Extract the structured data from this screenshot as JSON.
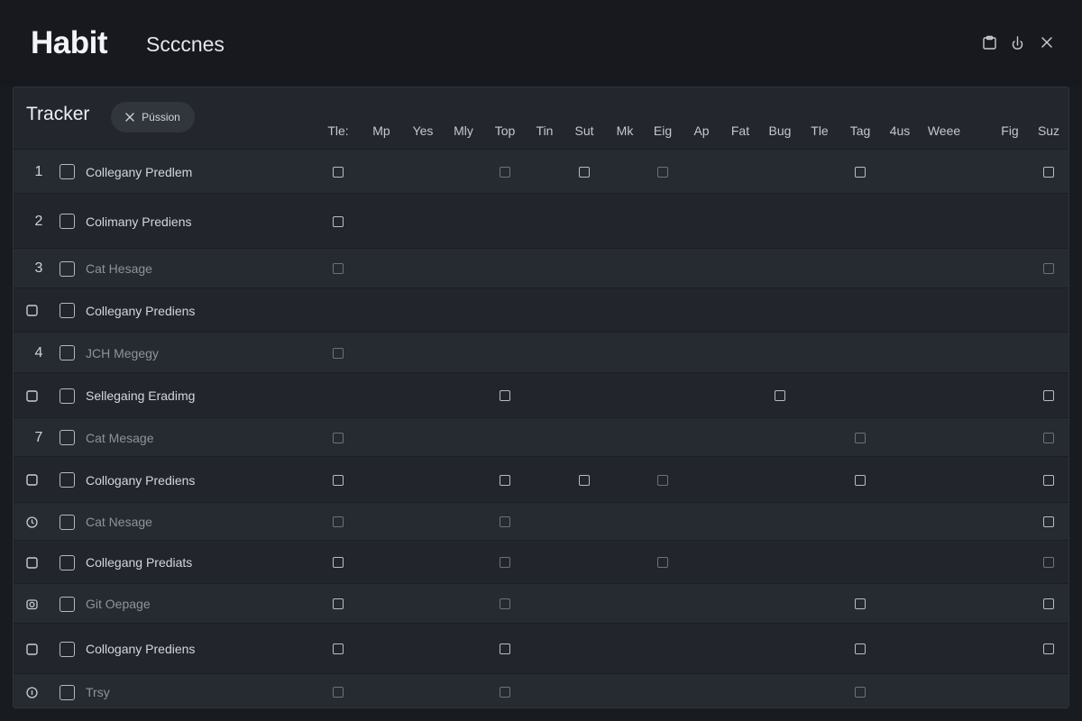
{
  "header": {
    "brand": "Habit",
    "section": "Scccnes",
    "controls": [
      {
        "name": "clipboard-icon"
      },
      {
        "name": "hand-icon"
      },
      {
        "name": "close-icon"
      }
    ]
  },
  "tracker": {
    "title": "Tracker",
    "chip_label": "Pússion",
    "columns": [
      "Tle:",
      "Mp",
      "Yes",
      "Mly",
      "Top",
      "Tin",
      "Sut",
      "Mk",
      "Eig",
      "Ap",
      "Fat",
      "Bug",
      "Tle",
      "Tag",
      "4us",
      "Weee",
      "",
      "Fig",
      "Suz"
    ],
    "rows": [
      {
        "marker": "1",
        "label": "Collegany Predlem",
        "dim": false,
        "checks": [
          0,
          4,
          6,
          8,
          13,
          18
        ],
        "dim_checks": [
          4,
          8
        ]
      },
      {
        "marker": "2",
        "label": "Colimany Prediens",
        "dim": false,
        "checks": [
          0
        ],
        "dim_checks": []
      },
      {
        "marker": "3",
        "label": "Cat Hesage",
        "dim": true,
        "checks": [
          0,
          18
        ],
        "dim_checks": [
          0,
          18
        ]
      },
      {
        "marker": "box",
        "label": "Collegany Prediens",
        "dim": false,
        "checks": [],
        "dim_checks": []
      },
      {
        "marker": "4",
        "label": "JCH Megegy",
        "dim": true,
        "checks": [
          0
        ],
        "dim_checks": [
          0
        ]
      },
      {
        "marker": "box",
        "label": "Sellegaing Eradimg",
        "dim": false,
        "checks": [
          4,
          11,
          18
        ],
        "dim_checks": []
      },
      {
        "marker": "7",
        "label": "Cat Mesage",
        "dim": true,
        "checks": [
          0,
          13,
          18
        ],
        "dim_checks": [
          0,
          13,
          18
        ]
      },
      {
        "marker": "box",
        "label": "Collogany Prediens",
        "dim": false,
        "checks": [
          0,
          4,
          6,
          8,
          13,
          18
        ],
        "dim_checks": [
          8
        ]
      },
      {
        "marker": "clock",
        "label": "Cat Nesage",
        "dim": true,
        "checks": [
          0,
          4,
          18
        ],
        "dim_checks": [
          0,
          4
        ]
      },
      {
        "marker": "box",
        "label": "Collegang Prediats",
        "dim": false,
        "checks": [
          0,
          4,
          8,
          18
        ],
        "dim_checks": [
          4,
          8,
          18
        ]
      },
      {
        "marker": "camera",
        "label": "Git Oepage",
        "dim": true,
        "checks": [
          0,
          4,
          13,
          18
        ],
        "dim_checks": [
          4
        ]
      },
      {
        "marker": "box",
        "label": "Collogany Prediens",
        "dim": false,
        "checks": [
          0,
          4,
          13,
          18
        ],
        "dim_checks": []
      },
      {
        "marker": "info",
        "label": "Trsy",
        "dim": true,
        "checks": [
          0,
          4,
          13
        ],
        "dim_checks": [
          0,
          4,
          13
        ]
      }
    ]
  }
}
